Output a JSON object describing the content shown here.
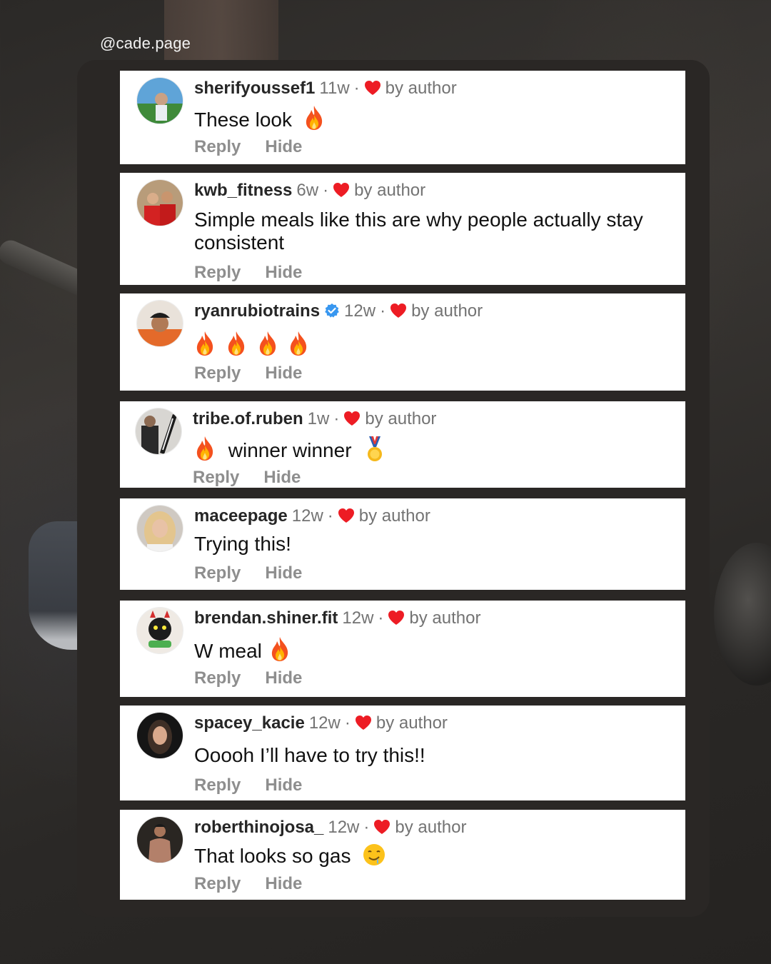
{
  "handle": "@cade.page",
  "colors": {
    "heart": "#ed1c24",
    "verified": "#3897f0",
    "panel": "#2a2725",
    "action_gray": "#8e8e8e"
  },
  "actions": {
    "reply": "Reply",
    "hide": "Hide"
  },
  "comments": [
    {
      "username": "sherifyoussef1",
      "time": "11w",
      "liked": "by author",
      "text": "These look",
      "emoji_after": [
        "fire-emoji"
      ],
      "avatar_icon": "avatar-outdoor-photo"
    },
    {
      "username": "kwb_fitness",
      "time": "6w",
      "liked": "by author",
      "text": "Simple meals like this are why people actually stay consistent",
      "emoji_after": [],
      "avatar_icon": "avatar-red-shirts-photo"
    },
    {
      "username": "ryanrubiotrains",
      "verified": true,
      "time": "12w",
      "liked": "by author",
      "text": "",
      "emoji_after": [
        "fire-emoji",
        "fire-emoji",
        "fire-emoji",
        "fire-emoji"
      ],
      "avatar_icon": "avatar-cap-photo"
    },
    {
      "username": "tribe.of.ruben",
      "time": "1w",
      "liked": "by author",
      "text": "winner winner",
      "emoji_before": [
        "fire-emoji"
      ],
      "emoji_after": [
        "medal-emoji"
      ],
      "avatar_icon": "avatar-gym-photo"
    },
    {
      "username": "maceepage",
      "time": "12w",
      "liked": "by author",
      "text": "Trying this!",
      "emoji_after": [],
      "avatar_icon": "avatar-blonde-photo"
    },
    {
      "username": "brendan.shiner.fit",
      "time": "12w",
      "liked": "by author",
      "text": "W meal",
      "emoji_after": [
        "fire-emoji"
      ],
      "avatar_icon": "avatar-cartoon-photo"
    },
    {
      "username": "spacey_kacie",
      "time": "12w",
      "liked": "by author",
      "text": "Ooooh I’ll have to try this!!",
      "emoji_after": [],
      "avatar_icon": "avatar-selfie-photo"
    },
    {
      "username": "roberthinojosa_",
      "time": "12w",
      "liked": "by author",
      "text": "That looks so gas",
      "emoji_after": [
        "drooling-emoji"
      ],
      "avatar_icon": "avatar-shirtless-photo"
    }
  ]
}
